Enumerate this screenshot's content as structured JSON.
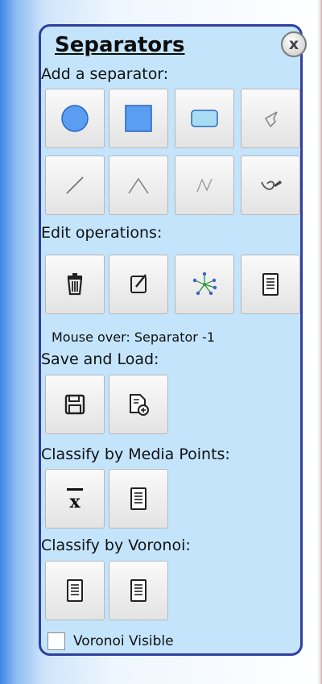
{
  "panel": {
    "title": "Separators",
    "close_glyph": "x"
  },
  "sections": {
    "add": "Add a separator:",
    "edit": "Edit operations:",
    "mouse_over": "Mouse over: Separator -1",
    "save_load": "Save and Load:",
    "media": "Classify by Media Points:",
    "voronoi": "Classify by Voronoi:"
  },
  "add_buttons": [
    {
      "icon": "circle-icon"
    },
    {
      "icon": "square-icon"
    },
    {
      "icon": "rounded-rectangle-icon"
    },
    {
      "icon": "polygon-icon"
    },
    {
      "icon": "line-icon"
    },
    {
      "icon": "curve-icon"
    },
    {
      "icon": "polyline-icon"
    },
    {
      "icon": "freehand-icon"
    }
  ],
  "edit_buttons": [
    {
      "icon": "trash-icon"
    },
    {
      "icon": "edit-icon"
    },
    {
      "icon": "star-network-icon"
    },
    {
      "icon": "document-icon"
    }
  ],
  "save_buttons": [
    {
      "icon": "save-icon"
    },
    {
      "icon": "load-icon"
    }
  ],
  "media_buttons": [
    {
      "icon": "mean-icon",
      "glyph": "x"
    },
    {
      "icon": "document-icon"
    }
  ],
  "voronoi_buttons": [
    {
      "icon": "document-icon"
    },
    {
      "icon": "document-icon"
    }
  ],
  "voronoi_visible": {
    "label": "Voronoi Visible",
    "checked": false
  },
  "colors": {
    "panel_bg": "#c3e4fb",
    "panel_border": "#2f3f9e",
    "shape_fill": "#5b9df0"
  }
}
